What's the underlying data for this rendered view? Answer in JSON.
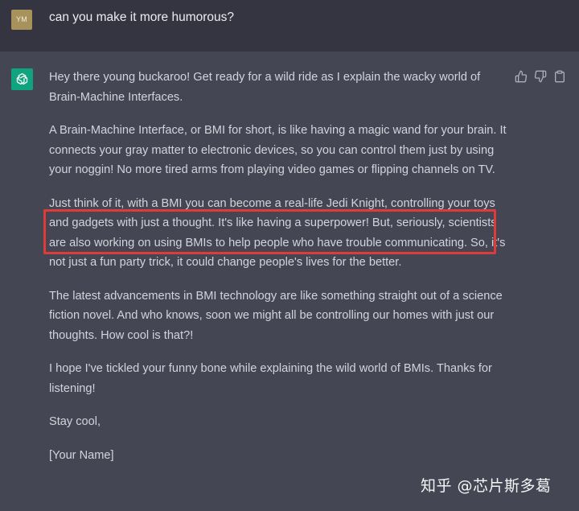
{
  "user_message": {
    "avatar_initials": "YM",
    "text": "can you make it more humorous?"
  },
  "assistant_message": {
    "avatar_icon": "openai-logo-icon",
    "paragraphs": [
      "Hey there young buckaroo! Get ready for a wild ride as I explain the wacky world of Brain-Machine Interfaces.",
      "A Brain-Machine Interface, or BMI for short, is like having a magic wand for your brain. It connects your gray matter to electronic devices, so you can control them just by using your noggin! No more tired arms from playing video games or flipping channels on TV.",
      "Just think of it, with a BMI you can become a real-life Jedi Knight, controlling your toys and gadgets with just a thought. It's like having a superpower! But, seriously, scientists are also working on using BMIs to help people who have trouble communicating. So, it's not just a fun party trick, it could change people's lives for the better.",
      "The latest advancements in BMI technology are like something straight out of a science fiction novel. And who knows, soon we might all be controlling our homes with just our thoughts. How cool is that?!",
      "I hope I've tickled your funny bone while explaining the wild world of BMIs. Thanks for listening!",
      "Stay cool,",
      "[Your Name]"
    ]
  },
  "actions": {
    "icons": [
      "thumbs-up-icon",
      "thumbs-down-icon",
      "copy-icon"
    ]
  },
  "watermark": "知乎 @芯片斯多葛",
  "colors": {
    "user_bg": "#343541",
    "assistant_bg": "#444654",
    "bot_avatar": "#10a37f",
    "user_avatar": "#a6925a",
    "highlight": "#e03b3b"
  }
}
